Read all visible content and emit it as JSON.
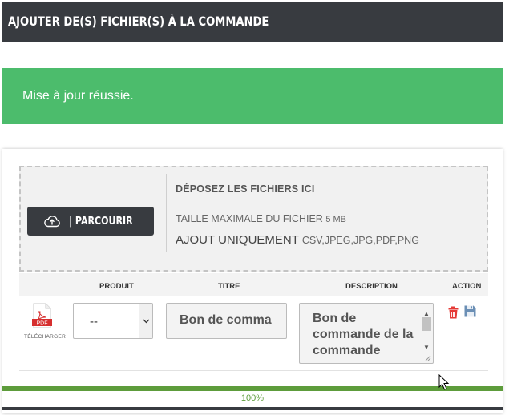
{
  "header": {
    "title": "AJOUTER DE(S) FICHIER(S) À LA COMMANDE"
  },
  "alert": {
    "message": "Mise à jour réussie."
  },
  "dropzone": {
    "browse_label": "| PARCOURIR",
    "browse_icon": "cloud-upload-icon",
    "title": "DÉPOSEZ LES FICHIERS ICI",
    "max_size_label": "TAILLE MAXIMALE DU FICHIER",
    "max_size_value": "5 MB",
    "types_label": "AJOUT UNIQUEMENT",
    "types_value": "CSV,JPEG,JPG,PDF,PNG"
  },
  "table": {
    "columns": [
      "PRODUIT",
      "TITRE",
      "DESCRIPTION",
      "ACTION"
    ],
    "rows": [
      {
        "file_type": "PDF",
        "download_label": "TÉLÉCHARGER",
        "product": "--",
        "title": "Bon de comma",
        "description": "Bon de commande de la commande"
      }
    ]
  },
  "progress": {
    "value": 100,
    "label": "100%"
  },
  "colors": {
    "header_bg": "#383b40",
    "success": "#4cbc6c",
    "progress": "#5d9c3b",
    "delete": "#e53935",
    "save": "#6b8fb5"
  }
}
